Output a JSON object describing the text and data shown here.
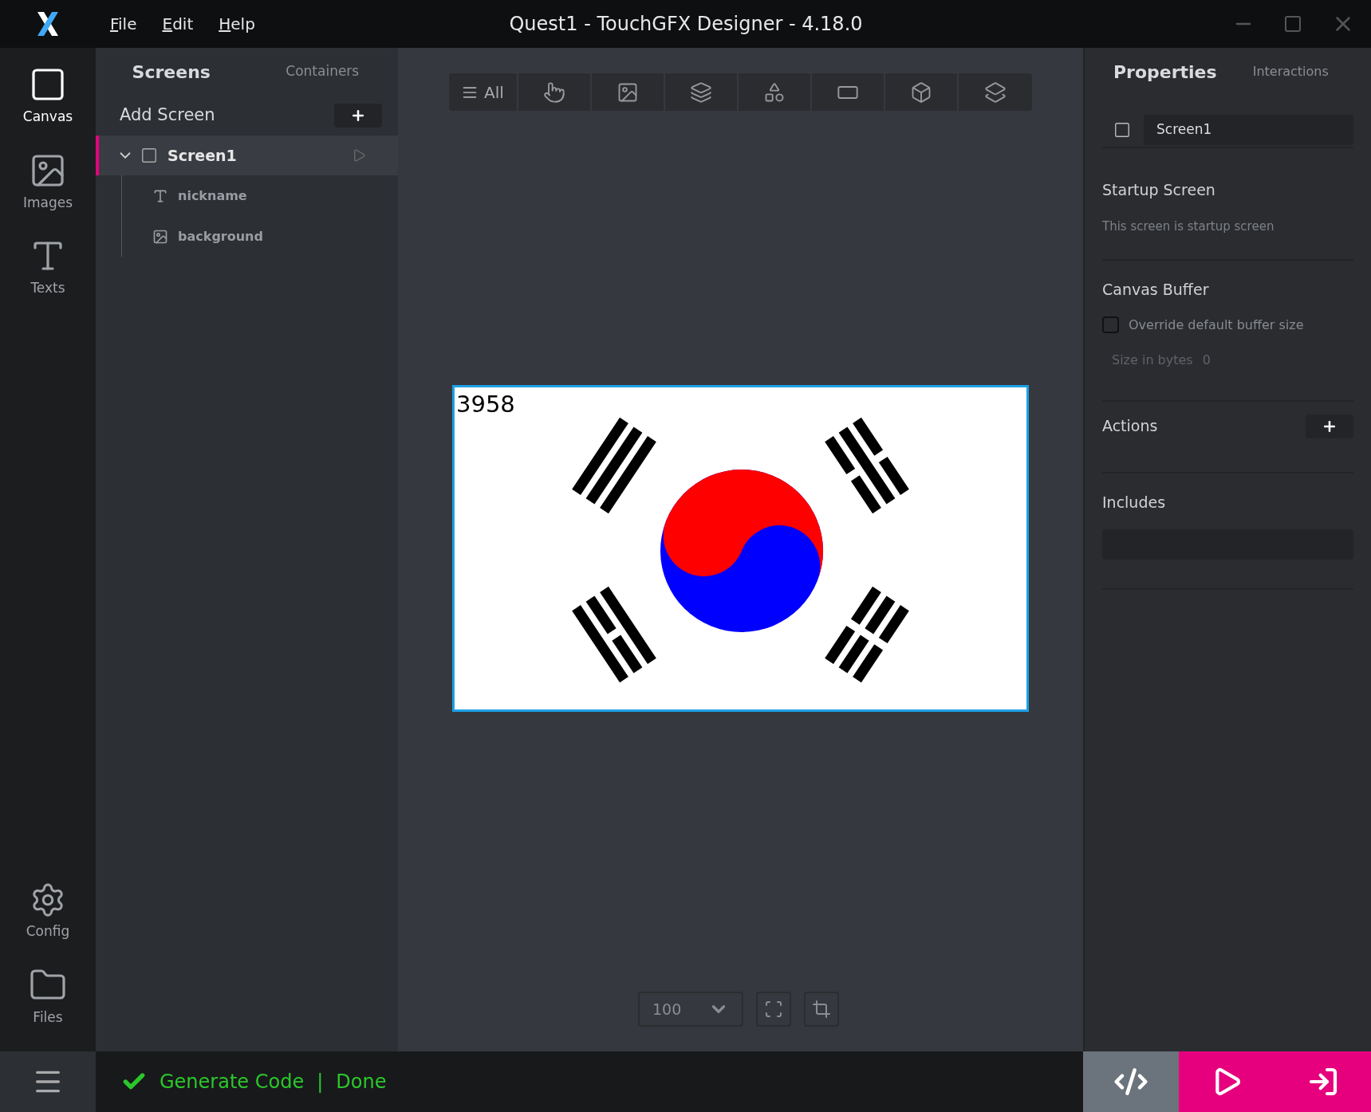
{
  "window": {
    "title": "Quest1 - TouchGFX Designer - 4.18.0"
  },
  "menu": [
    {
      "label": "File"
    },
    {
      "label": "Edit"
    },
    {
      "label": "Help"
    }
  ],
  "nav": [
    {
      "label": "Canvas",
      "selected": true
    },
    {
      "label": "Images",
      "selected": false
    },
    {
      "label": "Texts",
      "selected": false
    },
    {
      "label": "Config",
      "selected": false
    },
    {
      "label": "Files",
      "selected": false
    }
  ],
  "left_panel": {
    "tabs": [
      {
        "label": "Screens",
        "selected": true
      },
      {
        "label": "Containers",
        "selected": false
      }
    ],
    "add_screen": "Add Screen",
    "tree": [
      {
        "label": "Screen1",
        "expanded": true,
        "selected": true,
        "children": [
          {
            "label": "nickname",
            "kind": "text"
          },
          {
            "label": "background",
            "kind": "image"
          }
        ]
      }
    ]
  },
  "toolbar": {
    "all_label": "All"
  },
  "canvas": {
    "text_widget": "3958",
    "zoom": "100"
  },
  "properties": {
    "tabs": [
      {
        "label": "Properties",
        "selected": true
      },
      {
        "label": "Interactions",
        "selected": false
      }
    ],
    "screen_name": "Screen1",
    "startup": {
      "title": "Startup Screen",
      "note": "This screen is startup screen"
    },
    "buffer": {
      "title": "Canvas Buffer",
      "override_label": "Override default buffer size",
      "checked": false,
      "size_label": "Size in bytes",
      "size_value": "0"
    },
    "actions": {
      "title": "Actions"
    },
    "includes": {
      "title": "Includes"
    }
  },
  "status": {
    "ok": true,
    "text": "Generate Code",
    "separator": "|",
    "state": "Done"
  }
}
